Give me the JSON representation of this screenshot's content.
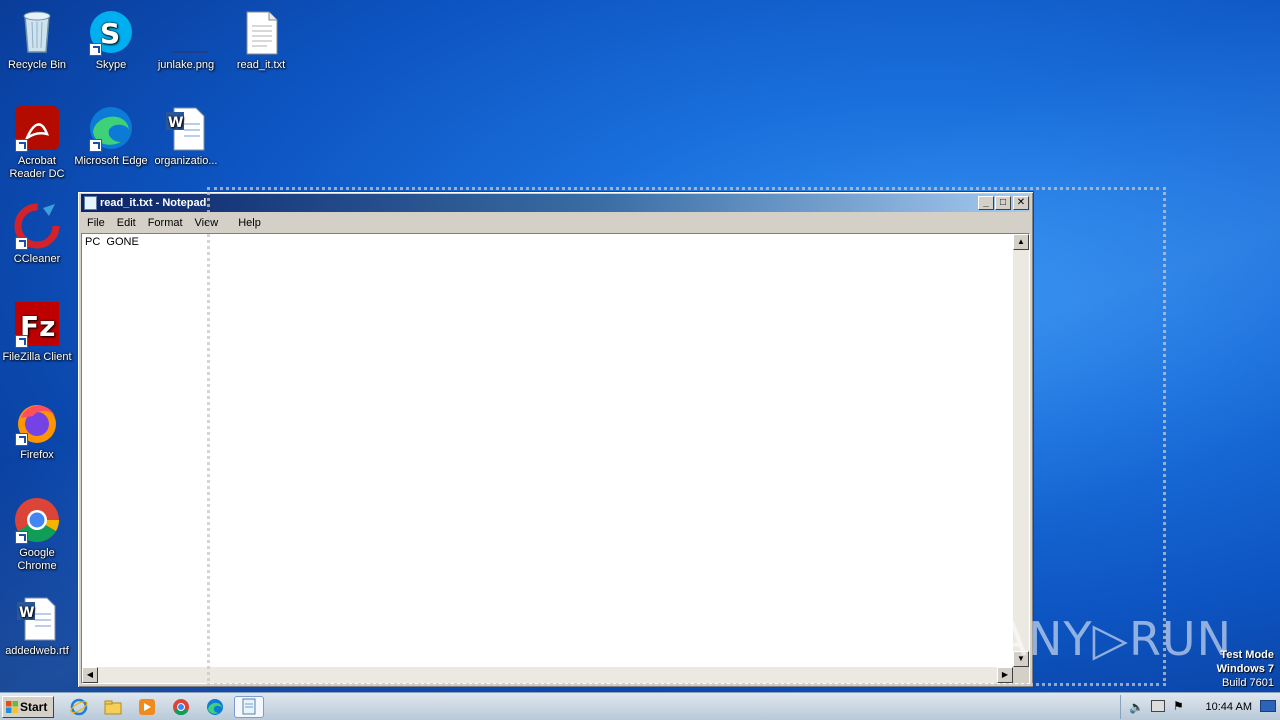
{
  "desktop": {
    "icons": [
      {
        "label": "Recycle Bin"
      },
      {
        "label": "Skype"
      },
      {
        "label": "junlake.png"
      },
      {
        "label": "read_it.txt"
      },
      {
        "label": "Acrobat Reader DC"
      },
      {
        "label": "Microsoft Edge"
      },
      {
        "label": "organizatio..."
      },
      {
        "label": "CCleaner"
      },
      {
        "label": "FileZilla Client"
      },
      {
        "label": "Firefox"
      },
      {
        "label": "Google Chrome"
      },
      {
        "label": "addedweb.rtf"
      }
    ]
  },
  "notepad": {
    "title": "read_it.txt - Notepad",
    "menu": [
      "File",
      "Edit",
      "Format",
      "View",
      "Help"
    ],
    "content": "PC  GONE",
    "minimize": "_",
    "maximize": "□",
    "close": "✕"
  },
  "watermark": "ANY▷RUN",
  "testmode": {
    "line1": "Test Mode",
    "line2": "Windows 7",
    "line3": "Build 7601"
  },
  "taskbar": {
    "start_label": "Start",
    "clock": "10:44 AM"
  },
  "colors": {
    "titlebar_start": "#0a246a",
    "desktop": "#1a6fdc"
  }
}
